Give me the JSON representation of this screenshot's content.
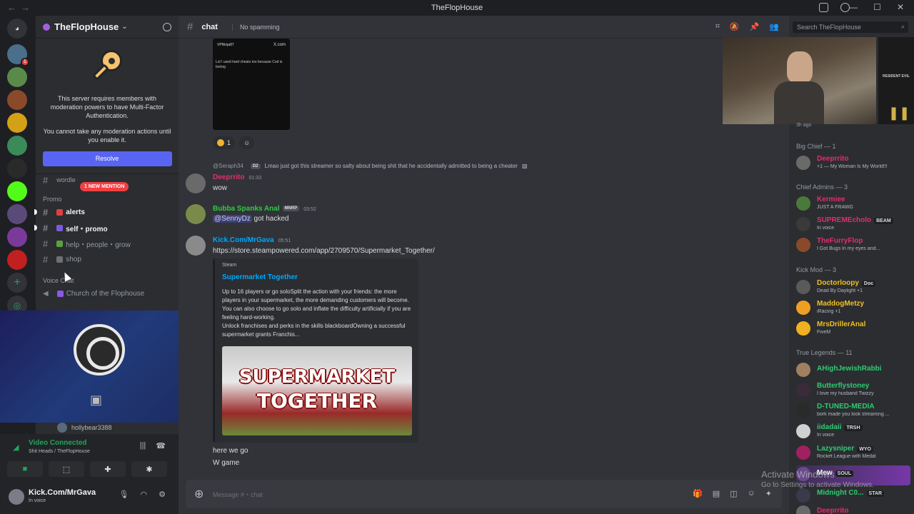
{
  "titlebar": {
    "title": "TheFlopHouse"
  },
  "server": {
    "name": "TheFlopHouse"
  },
  "mfa": {
    "line1": "This server requires members with moderation powers to have Multi-Factor Authentication.",
    "line2": "You cannot take any moderation actions until you enable it.",
    "resolve": "Resolve"
  },
  "channel_list": {
    "partial_top": "wordle",
    "new_mention": "1 NEW MENTION",
    "cat_promo": "Promo",
    "alerts": "alerts",
    "self_promo": "self・promo",
    "help": "help・people・grow",
    "shop": "shop",
    "cat_voice": "Voice Chat",
    "church": "Church of the Flophouse",
    "voice_user": "hollybear3388"
  },
  "voice": {
    "status": "Video Connected",
    "sub": "Shit Heads / TheFlopHouse"
  },
  "user": {
    "name": "Kick.Com/MrGava",
    "status": "In voice"
  },
  "header": {
    "channel": "chat",
    "topic": "No spamming"
  },
  "embed_small": {
    "handle": "VPNinja87",
    "site": "X.com",
    "text": "Lol I used hard cheats too because Cod is boring",
    "likes": "1"
  },
  "messages": {
    "reply_name": "@Seraph34",
    "reply_tag": "D2",
    "reply_text": "Lmao just got this streamer so salty about being shit that he accidentally admitted to being a cheater",
    "m1_name": "Deeprrito",
    "m1_time": "01:33",
    "m1_body": "wow",
    "m2_name": "Bubba Spanks Anal",
    "m2_tag": "MNRP",
    "m2_time": "03:52",
    "m2_mention": "@SennyDz",
    "m2_body": " got hacked",
    "m3_name": "Kick.Com/MrGava",
    "m3_time": "05:51",
    "m3_link": "https://store.steampowered.com/app/2709570/Supermarket_Together/",
    "m4_body": "here we go",
    "m5_body": "W game"
  },
  "steam": {
    "provider": "Steam",
    "title": "Supermarket Together",
    "desc1": "Up to 16 players or go soloSplit the action with your friends: the more players in your supermarket, the more demanding customers will become. You can also choose to go solo and inflate the difficulty artificially if you are feeling hard-working.",
    "desc2": "Unlock franchises and perks in the skills blackboardOwning a successful supermarket grants Franchis...",
    "img_line1": "SUPERMARKET",
    "img_line2": "TOGETHER"
  },
  "input": {
    "placeholder": "Message #・chat"
  },
  "search": {
    "placeholder": "Search TheFlopHouse"
  },
  "members": {
    "ago": "3h ago",
    "resident_evil": "RESIDENT EVIL",
    "g_bigchief": "Big Chief — 1",
    "deeprrito": "Deeprrito",
    "deeprrito_s": "+1 — My Woman Is My World!!!",
    "g_chief": "Chief Admins — 3",
    "kermiee": "Kermiee",
    "kermiee_s": "JUST A FRAWG",
    "supreme": "SUPREMEcholo",
    "supreme_t": "BEAM",
    "supreme_s": "In voice",
    "furry": "TheFurryFlop",
    "furry_s": "I Got Bugs In my eyes and...",
    "g_kickmod": "Kick Mod — 3",
    "doctor": "Doctorloopy",
    "doctor_t": "Doc",
    "doctor_s": "Dead By Daylight +1",
    "maddog": "MaddogMetzy",
    "maddog_s": "iRacing +1",
    "driller": "MrsDrillerAnal",
    "driller_s": "FiveM",
    "g_legends": "True Legends — 11",
    "ahigh": "AHighJewishRabbi",
    "butter": "Butterflystoney",
    "butter_s": "I love my husband Twizzy",
    "dtuned": "D-TUNED-MEDIA",
    "dtuned_s": "bork made you look streaming ...",
    "iida": "iidadaii",
    "iida_t": "TRSH",
    "iida_s": "In voice",
    "lazy": "Lazysniper",
    "lazy_t": "WYO",
    "lazy_s": "Rocket League with Medal",
    "mew": "Mew",
    "mew_t": "SOUL",
    "midnight": "Midnight C0...",
    "midnight_t": "STAR",
    "deeprrito2": "Deeprrito"
  },
  "activate": {
    "line1": "Activate Windows",
    "line2": "Go to Settings to activate Windows."
  }
}
